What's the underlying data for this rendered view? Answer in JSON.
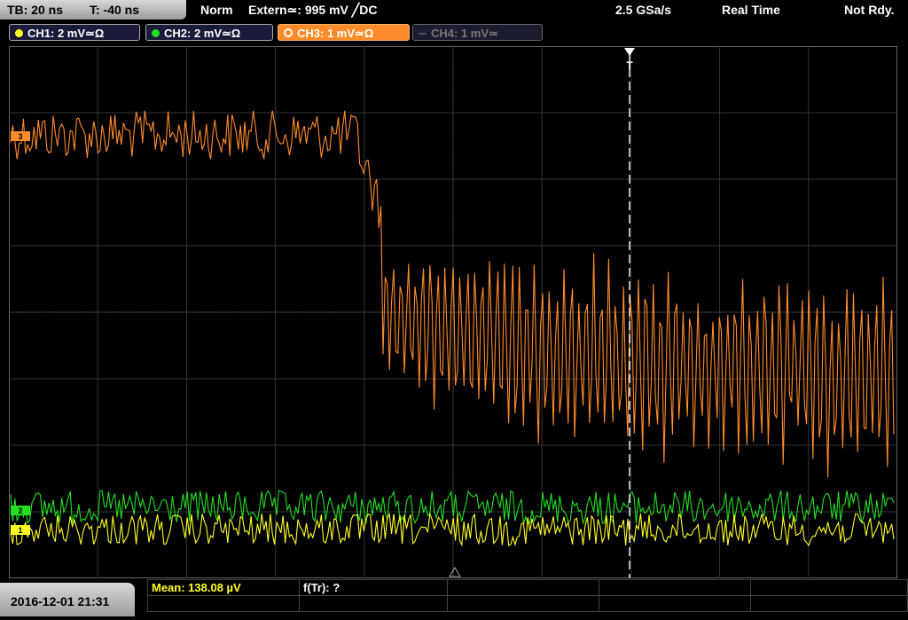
{
  "status_bar": {
    "timebase": "TB: 20 ns",
    "trigger_time": "T: -40 ns",
    "mode": "Norm",
    "trigger_source": "Extern≃: 995 mV ╱DC",
    "sample_rate": "2.5 GSa/s",
    "acq_mode": "Real Time",
    "state": "Not Rdy."
  },
  "channels": [
    {
      "label": "CH1: 2 mV≃Ω",
      "color": "#ffff20"
    },
    {
      "label": "CH2: 2 mV≃Ω",
      "color": "#20e020"
    },
    {
      "label": "CH3: 1 mV≃Ω",
      "color": "#ff8c2a"
    },
    {
      "label": "CH4: 1 mV≃",
      "color": "#707070"
    }
  ],
  "markers": {
    "ch1": "1",
    "ch2": "2",
    "ch3": "3",
    "trigger": "T"
  },
  "measurements": {
    "mean": "Mean: 138.08 µV",
    "rise": "f(Tr): ?"
  },
  "timestamp": "2016-12-01 21:31"
}
